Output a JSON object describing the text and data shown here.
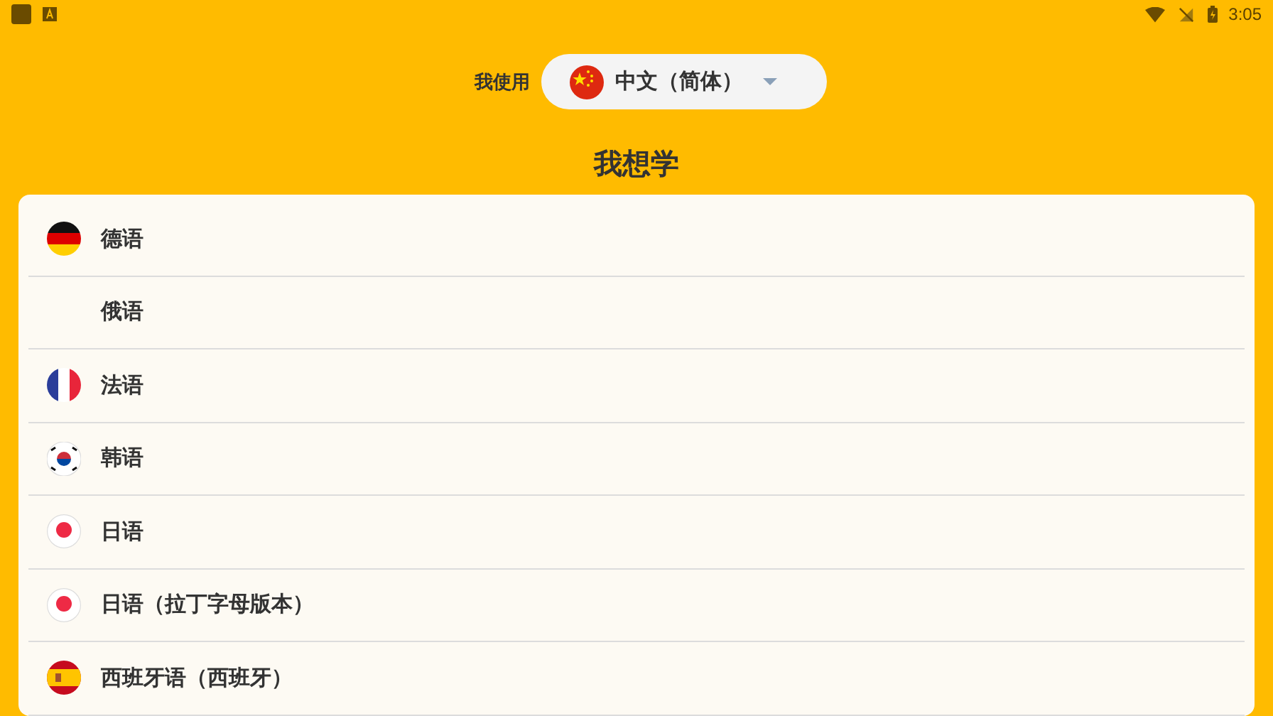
{
  "status_bar": {
    "time": "3:05"
  },
  "source_language": {
    "label": "我使用",
    "value": "中文（简体）",
    "kind": "cn"
  },
  "title": "我想学",
  "languages": [
    {
      "name": "德语",
      "kind": "de"
    },
    {
      "name": "俄语"
    },
    {
      "name": "法语",
      "kind": "fr"
    },
    {
      "name": "韩语",
      "kind": "kr"
    },
    {
      "name": "日语",
      "kind": "jp"
    },
    {
      "name": "日语（拉丁字母版本）",
      "kind": "jp"
    },
    {
      "name": "西班牙语（西班牙）",
      "kind": "es"
    }
  ]
}
